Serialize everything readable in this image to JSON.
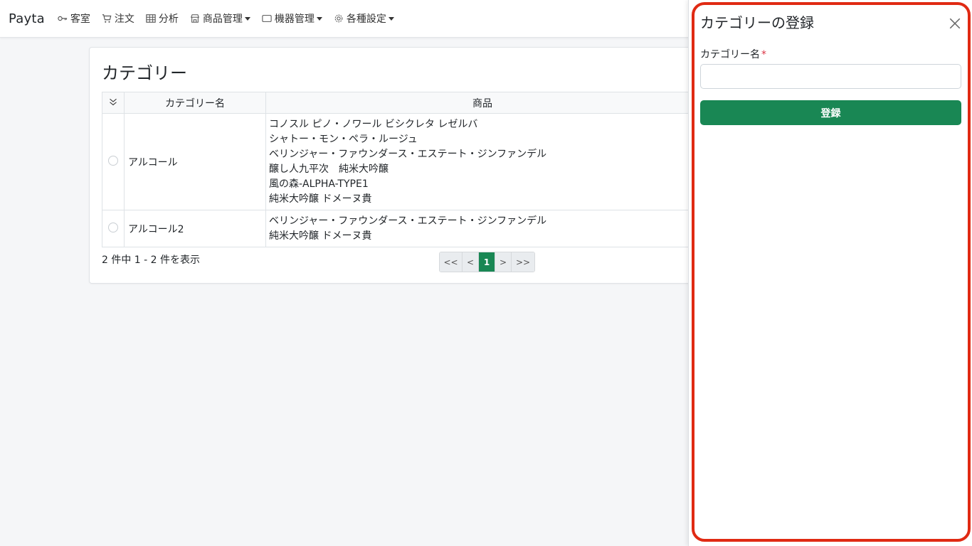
{
  "navbar": {
    "brand": "Payta",
    "items": [
      {
        "label": "客室",
        "icon": "key-icon",
        "dropdown": false
      },
      {
        "label": "注文",
        "icon": "cart-icon",
        "dropdown": false
      },
      {
        "label": "分析",
        "icon": "table-icon",
        "dropdown": false
      },
      {
        "label": "商品管理",
        "icon": "shop-icon",
        "dropdown": true
      },
      {
        "label": "機器管理",
        "icon": "tablet-icon",
        "dropdown": true
      },
      {
        "label": "各種設定",
        "icon": "gear-icon",
        "dropdown": true
      }
    ]
  },
  "card": {
    "title": "カテゴリー",
    "table": {
      "headers": [
        "",
        "カテゴリー名",
        "商品"
      ],
      "rows": [
        {
          "name": "アルコール",
          "products": [
            "コノスル ピノ・ノワール ビシクレタ レゼルバ",
            "シャトー・モン・ペラ・ルージュ",
            "ベリンジャー・ファウンダース・エステート・ジンファンデル",
            "醸し人九平次　純米大吟醸",
            "風の森-ALPHA-TYPE1",
            "純米大吟醸 ドメーヌ貴"
          ]
        },
        {
          "name": "アルコール2",
          "products": [
            "ベリンジャー・ファウンダース・エステート・ジンファンデル",
            "純米大吟醸 ドメーヌ貴"
          ]
        }
      ]
    },
    "count_text": "2 件中 1 - 2 件を表示",
    "pagination": {
      "first": "<<",
      "prev": "<",
      "current": "1",
      "next": ">",
      "last": ">>"
    }
  },
  "offcanvas": {
    "title": "カテゴリーの登録",
    "field_label": "カテゴリー名",
    "required_mark": "*",
    "input_value": "",
    "submit_label": "登録"
  },
  "colors": {
    "accent": "#198754",
    "highlight": "#e02a13",
    "required": "#dc3545"
  }
}
